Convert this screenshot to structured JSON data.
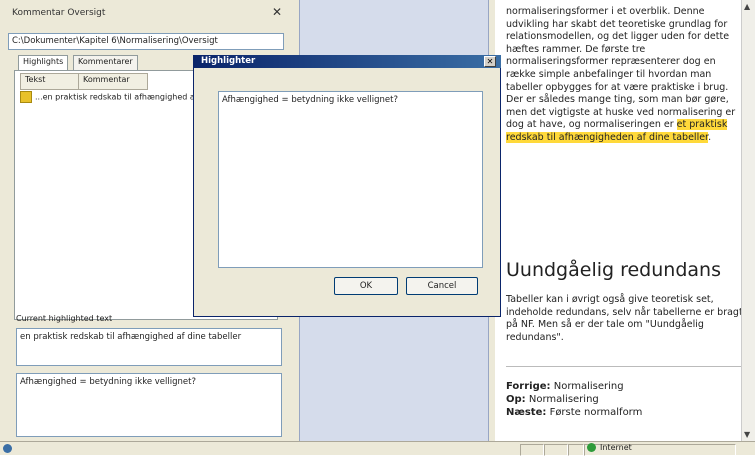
{
  "left_panel": {
    "title": "Kommentar Oversigt",
    "close_icon": "close-icon",
    "path": "C:\\Dokumenter\\Kapitel 6\\Normalisering\\Oversigt",
    "tabs": [
      "Highlights",
      "Kommentarer"
    ],
    "columns": [
      "Tekst",
      "Kommentar"
    ],
    "rows": [
      {
        "icon": "highlight-icon",
        "text": "...en praktisk redskab til afhængighed af dine tabeller"
      }
    ],
    "current_label": "Current highlighted text",
    "current_text": "en praktisk redskab til afhængighed af dine tabeller",
    "comment_text": "Afhængighed = betydning ikke vellignet?"
  },
  "dialog": {
    "title": "Highlighter",
    "close_icon": "close-icon",
    "text": "Afhængighed = betydning ikke vellignet?",
    "ok_label": "OK",
    "cancel_label": "Cancel"
  },
  "document": {
    "para1_before": "normaliseringsformer i et overblik. Denne udvikling har skabt det teoretiske grundlag for relationsmodellen, og det ligger uden for dette hæftes rammer. De første tre normaliseringsformer repræsenterer dog en række simple anbefalinger til hvordan man tabeller opbygges for at være praktiske i brug. Der er således mange ting, som man bør gøre, men det vigtigste at huske ved normalisering er dog at have, og normaliseringen er",
    "para1_highlight": "et praktisk redskab til afhængigheden af dine tabeller",
    "para1_after": ".",
    "heading": "Uundgåelig redundans",
    "para2": "Tabeller kan i øvrigt også give teoretisk set, indeholde redundans, selv når tabellerne er bragt på NF. Men så er der tale om \"Uundgåelig redundans\".",
    "meta": {
      "prev_label": "Forrige:",
      "prev_value": "Normalisering",
      "up_label": "Op:",
      "up_value": "Normalisering",
      "next_label": "Næste:",
      "next_value": "Første normalform"
    }
  },
  "status_bar": {
    "zone_label": "Internet",
    "zone_icon": "globe-icon",
    "page_icon": "ie-icon"
  }
}
